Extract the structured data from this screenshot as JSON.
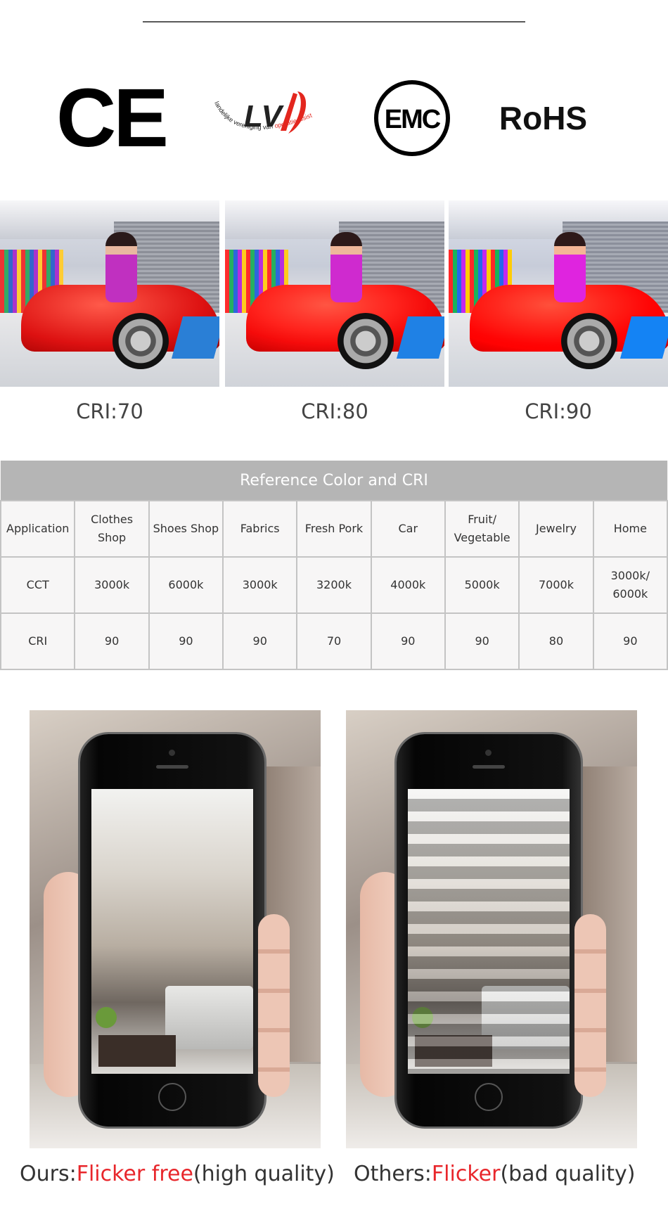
{
  "certifications": [
    {
      "name": "CE",
      "text": "CE"
    },
    {
      "name": "LVO",
      "text": "LVO",
      "subtitle": "landelijke vereniging van operatieassistenten"
    },
    {
      "name": "EMC",
      "text": "EMC"
    },
    {
      "name": "RoHS",
      "text": "RoHS"
    }
  ],
  "cri_samples": [
    {
      "label": "CRI:70"
    },
    {
      "label": "CRI:80"
    },
    {
      "label": "CRI:90"
    }
  ],
  "table": {
    "title": "Reference Color and CRI",
    "rows": [
      [
        "Application",
        "Clothes Shop",
        "Shoes Shop",
        "Fabrics",
        "Fresh Pork",
        "Car",
        "Fruit/ Vegetable",
        "Jewelry",
        "Home"
      ],
      [
        "CCT",
        "3000k",
        "6000k",
        "3000k",
        "3200k",
        "4000k",
        "5000k",
        "7000k",
        "3000k/ 6000k"
      ],
      [
        "CRI",
        "90",
        "90",
        "90",
        "70",
        "90",
        "90",
        "80",
        "90"
      ]
    ]
  },
  "comparison": {
    "ours": {
      "prefix": "Ours:",
      "highlight": "Flicker free",
      "suffix": "(high quality)"
    },
    "others": {
      "prefix": "Others:",
      "highlight": "Flicker",
      "suffix": "(bad quality)"
    }
  },
  "colors": {
    "highlight": "#e8262b",
    "table_header": "#b5b5b5",
    "lvo_red": "#e3261e"
  }
}
